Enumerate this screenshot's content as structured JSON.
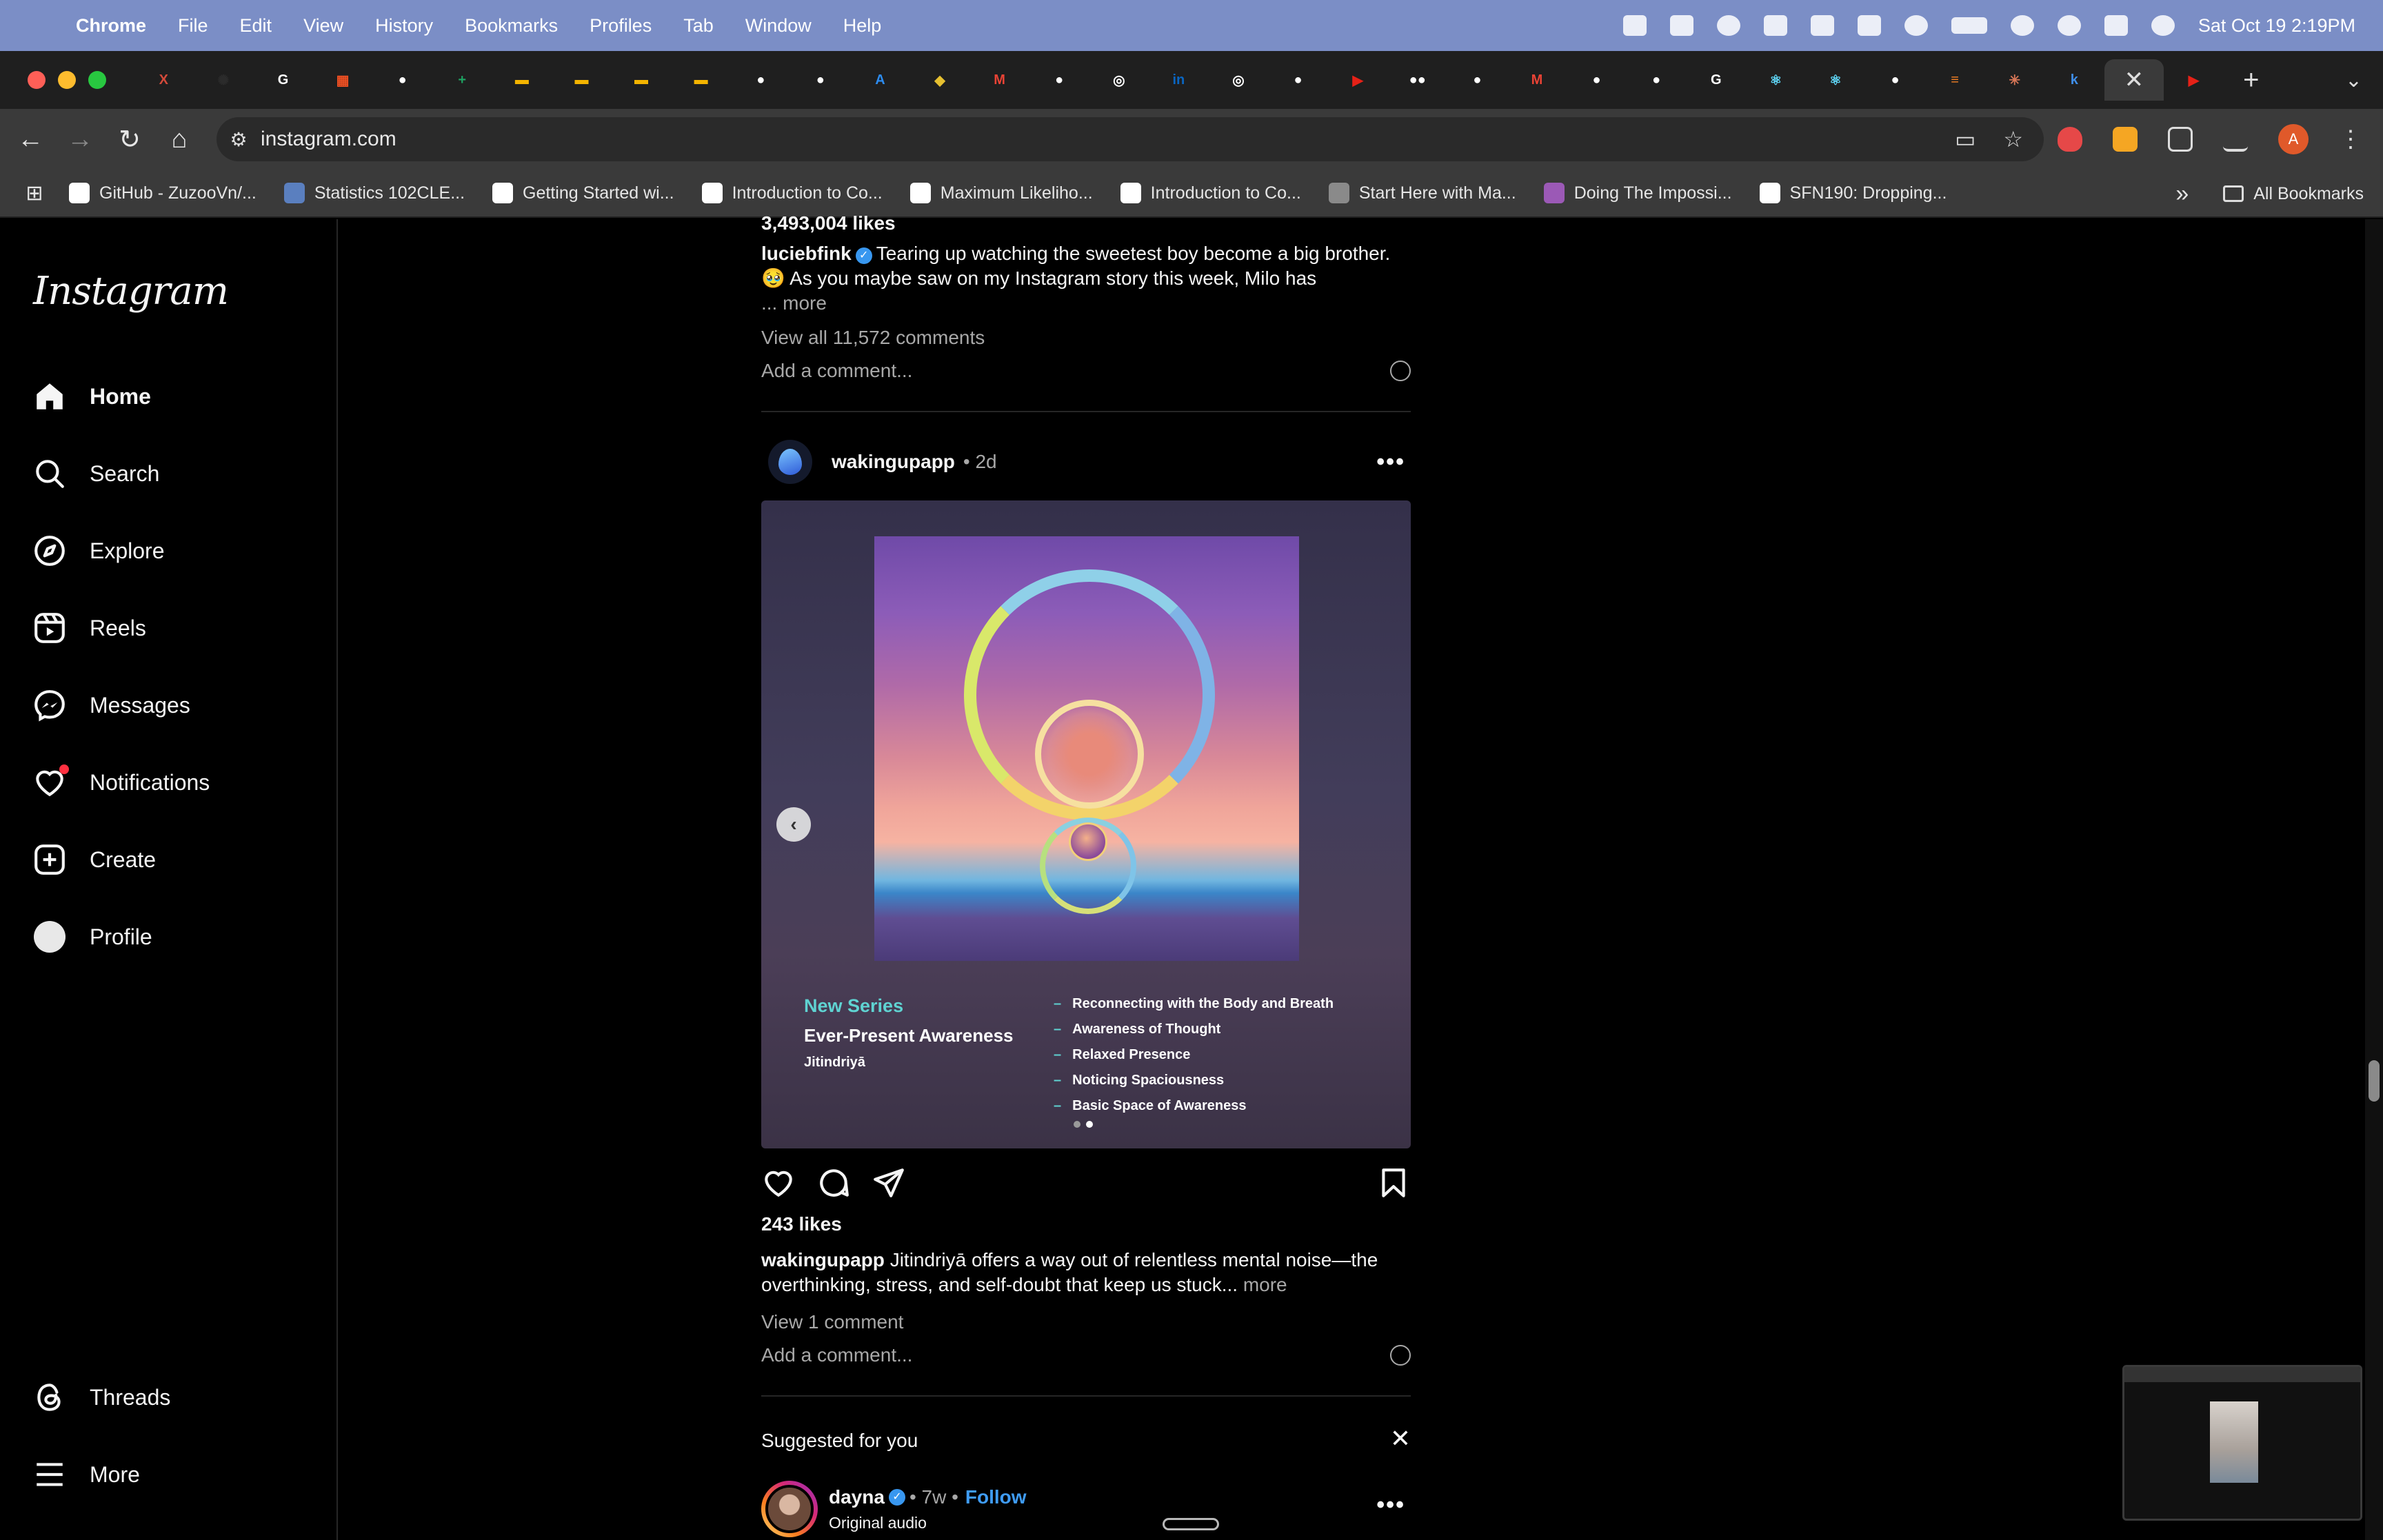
{
  "menubar": {
    "app_name": "Chrome",
    "items": [
      "File",
      "Edit",
      "View",
      "History",
      "Bookmarks",
      "Profiles",
      "Tab",
      "Window",
      "Help"
    ],
    "clock": "Sat Oct 19  2:19PM"
  },
  "tabs": {
    "favicons": [
      {
        "icon": "x-close-icon",
        "glyph": "X",
        "color": "#d44a3a"
      },
      {
        "icon": "openai-icon",
        "glyph": "✺",
        "color": "#2b2b2b"
      },
      {
        "icon": "google-icon",
        "glyph": "G",
        "color": "#ffffff"
      },
      {
        "icon": "microsoft-icon",
        "glyph": "▦",
        "color": "#f25022"
      },
      {
        "icon": "github-icon",
        "glyph": "●",
        "color": "#ffffff"
      },
      {
        "icon": "google-sheets-icon",
        "glyph": "+",
        "color": "#1ea362"
      },
      {
        "icon": "google-slides-icon",
        "glyph": "▬",
        "color": "#f4b400"
      },
      {
        "icon": "google-slides-icon",
        "glyph": "▬",
        "color": "#f4b400"
      },
      {
        "icon": "google-slides-icon",
        "glyph": "▬",
        "color": "#f4b400"
      },
      {
        "icon": "google-slides-icon",
        "glyph": "▬",
        "color": "#f4b400"
      },
      {
        "icon": "github-icon",
        "glyph": "●",
        "color": "#ffffff"
      },
      {
        "icon": "github-icon",
        "glyph": "●",
        "color": "#ffffff"
      },
      {
        "icon": "app-store-icon",
        "glyph": "A",
        "color": "#2d8cf0"
      },
      {
        "icon": "badge-icon",
        "glyph": "◆",
        "color": "#e6c030"
      },
      {
        "icon": "gmail-icon",
        "glyph": "M",
        "color": "#ea4335"
      },
      {
        "icon": "github-icon",
        "glyph": "●",
        "color": "#ffffff"
      },
      {
        "icon": "chrome-icon",
        "glyph": "◎",
        "color": "#ffffff"
      },
      {
        "icon": "linkedin-icon",
        "glyph": "in",
        "color": "#0a66c2"
      },
      {
        "icon": "chrome-icon",
        "glyph": "◎",
        "color": "#ffffff"
      },
      {
        "icon": "github-icon",
        "glyph": "●",
        "color": "#ffffff"
      },
      {
        "icon": "youtube-icon",
        "glyph": "▶",
        "color": "#e62117"
      },
      {
        "icon": "medium-icon",
        "glyph": "●●",
        "color": "#ffffff"
      },
      {
        "icon": "github-icon",
        "glyph": "●",
        "color": "#ffffff"
      },
      {
        "icon": "gmail-icon",
        "glyph": "M",
        "color": "#ea4335"
      },
      {
        "icon": "github-icon",
        "glyph": "●",
        "color": "#ffffff"
      },
      {
        "icon": "github-icon",
        "glyph": "●",
        "color": "#ffffff"
      },
      {
        "icon": "google-icon",
        "glyph": "G",
        "color": "#ffffff"
      },
      {
        "icon": "react-icon",
        "glyph": "⚛",
        "color": "#61dafb"
      },
      {
        "icon": "react-icon",
        "glyph": "⚛",
        "color": "#61dafb"
      },
      {
        "icon": "github-icon",
        "glyph": "●",
        "color": "#ffffff"
      },
      {
        "icon": "stack-icon",
        "glyph": "≡",
        "color": "#f48024"
      },
      {
        "icon": "claude-icon",
        "glyph": "✳",
        "color": "#d97757"
      },
      {
        "icon": "k-icon",
        "glyph": "k",
        "color": "#3f8ee8"
      }
    ],
    "active_close": "✕",
    "after_active": {
      "icon": "youtube-icon",
      "glyph": "▶",
      "color": "#e62117"
    },
    "new_tab": "+",
    "menu": "⌄"
  },
  "toolbar": {
    "url": "instagram.com",
    "profile_initial": "A"
  },
  "bookmarks": {
    "items": [
      {
        "label": "GitHub - ZuzooVn/...",
        "color": "#ffffff"
      },
      {
        "label": "Statistics 102CLE...",
        "color": "#5a7fbf"
      },
      {
        "label": "Getting Started wi...",
        "color": "#ffffff"
      },
      {
        "label": "Introduction to Co...",
        "color": "#ffffff"
      },
      {
        "label": "Maximum Likeliho...",
        "color": "#ffffff"
      },
      {
        "label": "Introduction to Co...",
        "color": "#ffffff"
      },
      {
        "label": "Start Here with Ma...",
        "color": "#8a8a8a"
      },
      {
        "label": "Doing The Impossi...",
        "color": "#9b59b6"
      },
      {
        "label": "SFN190: Dropping...",
        "color": "#ffffff"
      }
    ],
    "overflow": "»",
    "all_bookmarks": "All Bookmarks"
  },
  "instagram": {
    "logo": "Instagram",
    "nav": [
      {
        "label": "Home",
        "icon": "home-icon",
        "active": true
      },
      {
        "label": "Search",
        "icon": "search-icon"
      },
      {
        "label": "Explore",
        "icon": "compass-icon"
      },
      {
        "label": "Reels",
        "icon": "reels-icon"
      },
      {
        "label": "Messages",
        "icon": "messenger-icon"
      },
      {
        "label": "Notifications",
        "icon": "heart-icon"
      },
      {
        "label": "Create",
        "icon": "plus-square-icon"
      },
      {
        "label": "Profile",
        "icon": "profile-avatar"
      }
    ],
    "bottom_nav": [
      {
        "label": "Threads",
        "icon": "threads-icon"
      },
      {
        "label": "More",
        "icon": "hamburger-icon"
      }
    ]
  },
  "post1": {
    "likes": "3,493,004 likes",
    "user": "luciebfink",
    "caption": "Tearing up watching the sweetest boy become a big brother. 🥹 As you maybe saw on my Instagram story this week, Milo has",
    "more": "... more",
    "view_comments": "View all 11,572 comments",
    "add_comment": "Add a comment..."
  },
  "post2": {
    "user": "wakingupapp",
    "time": "• 2d",
    "image": {
      "series_label": "New Series",
      "series_title": "Ever-Present Awareness",
      "series_teacher": "Jitindriyā",
      "lessons": [
        "Reconnecting with the Body and Breath",
        "Awareness of Thought",
        "Relaxed Presence",
        "Noticing Spaciousness",
        "Basic Space of Awareness"
      ],
      "dash": "–",
      "slide_count": 2,
      "current_slide": 2
    },
    "likes": "243 likes",
    "caption_user": "wakingupapp",
    "caption": "Jitindriyā offers a way out of relentless mental noise—the overthinking, stress, and self-doubt that keep us stuck...",
    "more": "more",
    "view_comments": "View 1 comment",
    "add_comment": "Add a comment..."
  },
  "suggested": {
    "title": "Suggested for you",
    "close": "✕",
    "user": "dayna",
    "time": "• 7w •",
    "follow": "Follow",
    "subtitle": "Original audio"
  },
  "colors": {
    "menubar": "#7b8ec6",
    "accent_blue": "#3f9cf5",
    "notification_dot": "#ff3040"
  }
}
